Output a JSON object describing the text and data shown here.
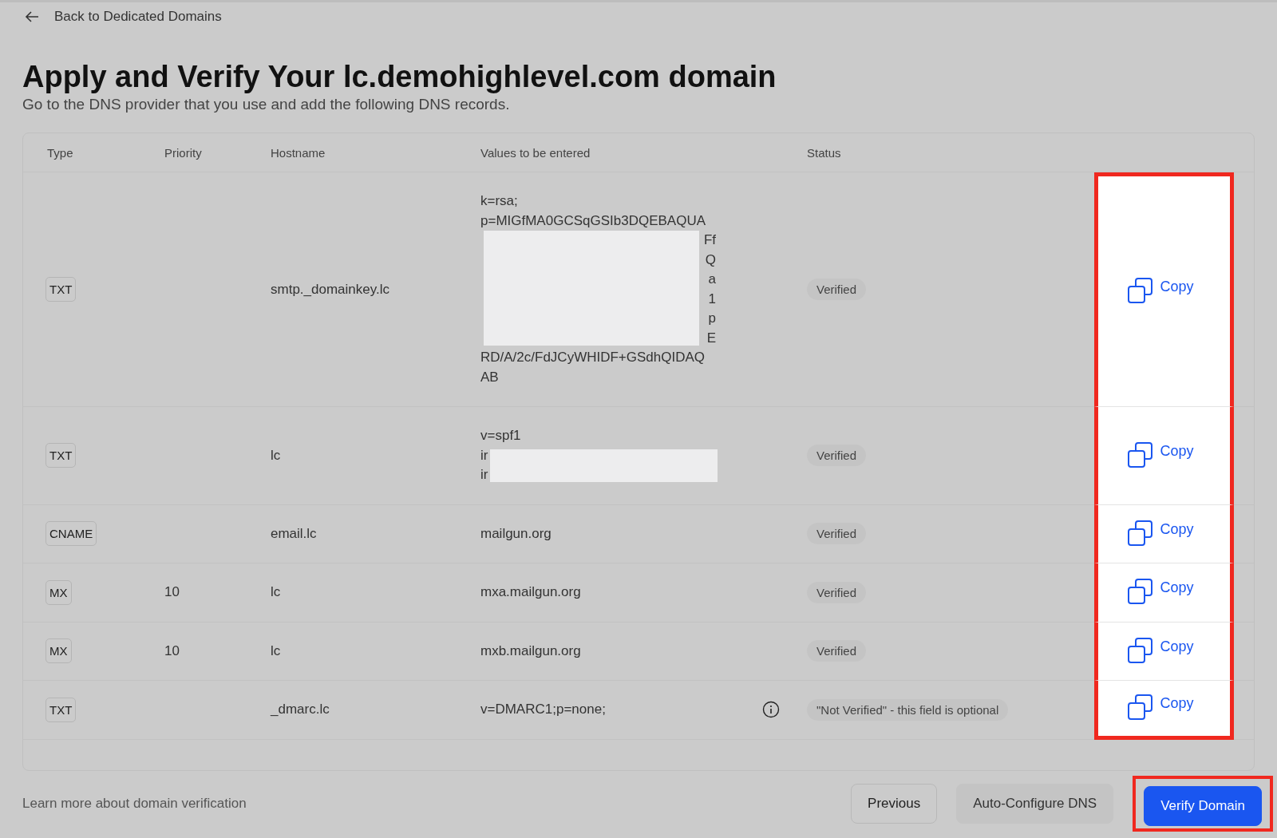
{
  "back_link": "Back to Dedicated Domains",
  "title": "Apply and Verify Your lc.demohighlevel.com domain",
  "subtitle": "Go to the DNS provider that you use and add the following DNS records.",
  "table": {
    "columns": [
      "Type",
      "Priority",
      "Hostname",
      "Values to be entered",
      "Status"
    ],
    "rows": [
      {
        "type": "TXT",
        "priority": "",
        "hostname": "smtp._domainkey.lc",
        "value_lines": [
          {
            "kind": "text",
            "text": "k=rsa;"
          },
          {
            "kind": "text",
            "text": "p=MIGfMA0GCSqGSIb3DQEBAQUA"
          },
          {
            "kind": "redacted_end",
            "text": "Ff"
          },
          {
            "kind": "redacted_end",
            "text": "Q"
          },
          {
            "kind": "redacted_end",
            "text": "a"
          },
          {
            "kind": "redacted_end",
            "text": "1"
          },
          {
            "kind": "redacted_end",
            "text": "p"
          },
          {
            "kind": "redacted_end",
            "text": "E"
          },
          {
            "kind": "text",
            "text": "RD/A/2c/FdJCyWHIDF+GSdhQIDAQ"
          },
          {
            "kind": "text",
            "text": "AB"
          }
        ],
        "info": false,
        "status": "Verified",
        "copy": "Copy"
      },
      {
        "type": "TXT",
        "priority": "",
        "hostname": "lc",
        "value_lines": [
          {
            "kind": "text",
            "text": "v=spf1"
          },
          {
            "kind": "redacted_start",
            "text": "ir"
          },
          {
            "kind": "redacted_start",
            "text": "ir"
          }
        ],
        "info": false,
        "status": "Verified",
        "copy": "Copy"
      },
      {
        "type": "CNAME",
        "priority": "",
        "hostname": "email.lc",
        "value_lines": [
          {
            "kind": "text",
            "text": "mailgun.org"
          }
        ],
        "info": false,
        "status": "Verified",
        "copy": "Copy"
      },
      {
        "type": "MX",
        "priority": "10",
        "hostname": "lc",
        "value_lines": [
          {
            "kind": "text",
            "text": "mxa.mailgun.org"
          }
        ],
        "info": false,
        "status": "Verified",
        "copy": "Copy"
      },
      {
        "type": "MX",
        "priority": "10",
        "hostname": "lc",
        "value_lines": [
          {
            "kind": "text",
            "text": "mxb.mailgun.org"
          }
        ],
        "info": false,
        "status": "Verified",
        "copy": "Copy"
      },
      {
        "type": "TXT",
        "priority": "",
        "hostname": "_dmarc.lc",
        "value_lines": [
          {
            "kind": "text",
            "text": "v=DMARC1;p=none;"
          }
        ],
        "info": true,
        "status": "\"Not Verified\"  -  this field is optional",
        "copy": "Copy"
      }
    ]
  },
  "learn_more": "Learn more about domain verification",
  "buttons": [
    {
      "label": "Previous",
      "kind": "secondary"
    },
    {
      "label": "Auto-Configure DNS",
      "kind": "tertiary"
    },
    {
      "label": "Verify Domain",
      "kind": "primary"
    }
  ]
}
